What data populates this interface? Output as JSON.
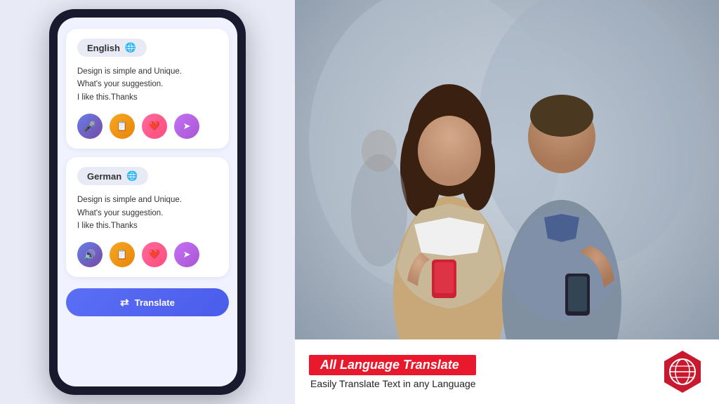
{
  "app": {
    "title": "All Language Translate"
  },
  "phone": {
    "background_color": "#1a1a2e",
    "screen_color": "#f0f2ff"
  },
  "source_card": {
    "language": "English",
    "globe_emoji": "🌐",
    "text": "Design is simple and Unique.\nWhat's your suggestion.\nI like this.Thanks",
    "buttons": [
      {
        "id": "mic",
        "emoji": "🎤",
        "label": "microphone"
      },
      {
        "id": "copy",
        "emoji": "📋",
        "label": "copy"
      },
      {
        "id": "like",
        "emoji": "❤️",
        "label": "like"
      },
      {
        "id": "share",
        "emoji": "↗",
        "label": "share"
      }
    ]
  },
  "target_card": {
    "language": "German",
    "globe_emoji": "🌐",
    "text": "Design is simple and Unique.\nWhat's your suggestion.\nI like this.Thanks",
    "buttons": [
      {
        "id": "speaker",
        "emoji": "🔊",
        "label": "speaker"
      },
      {
        "id": "copy",
        "emoji": "📋",
        "label": "copy"
      },
      {
        "id": "like",
        "emoji": "❤️",
        "label": "like"
      },
      {
        "id": "share",
        "emoji": "↗",
        "label": "share"
      }
    ]
  },
  "translate_button": {
    "label": "Translate",
    "icon": "⇄"
  },
  "banner": {
    "title": "All Language Translate",
    "subtitle": "Easily Translate Text in any  Language"
  }
}
